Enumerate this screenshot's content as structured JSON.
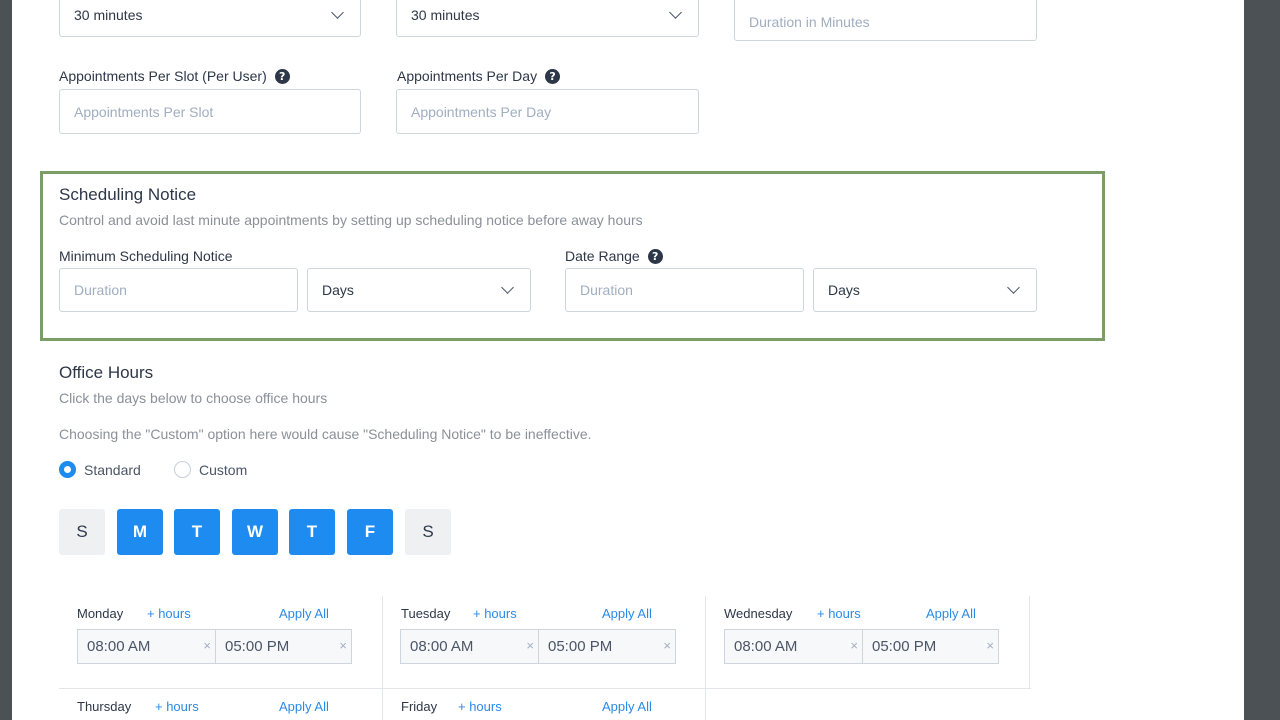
{
  "top_fields": {
    "select_1_value": "30 minutes",
    "select_2_value": "30 minutes",
    "duration_placeholder": "Duration in Minutes",
    "per_slot_label": "Appointments Per Slot (Per User)",
    "per_slot_placeholder": "Appointments Per Slot",
    "per_day_label": "Appointments Per Day",
    "per_day_placeholder": "Appointments Per Day",
    "help_glyph": "?"
  },
  "scheduling_notice": {
    "title": "Scheduling Notice",
    "description": "Control and avoid last minute appointments by setting up scheduling notice before away hours",
    "min_label": "Minimum Scheduling Notice",
    "min_placeholder": "Duration",
    "min_unit": "Days",
    "range_label": "Date Range",
    "range_placeholder": "Duration",
    "range_unit": "Days"
  },
  "office_hours": {
    "title": "Office Hours",
    "description": "Click the days below to choose office hours",
    "warning": "Choosing the \"Custom\" option here would cause \"Scheduling Notice\" to be ineffective.",
    "radio_standard": "Standard",
    "radio_custom": "Custom",
    "selected_mode": "Standard",
    "days": [
      {
        "letter": "S",
        "active": false
      },
      {
        "letter": "M",
        "active": true
      },
      {
        "letter": "T",
        "active": true
      },
      {
        "letter": "W",
        "active": true
      },
      {
        "letter": "T",
        "active": true
      },
      {
        "letter": "F",
        "active": true
      },
      {
        "letter": "S",
        "active": false
      }
    ],
    "add_hours": "+ hours",
    "apply_all": "Apply All",
    "clear_glyph": "×",
    "schedule": [
      {
        "day": "Monday",
        "start": "08:00 AM",
        "end": "05:00 PM"
      },
      {
        "day": "Tuesday",
        "start": "08:00 AM",
        "end": "05:00 PM"
      },
      {
        "day": "Wednesday",
        "start": "08:00 AM",
        "end": "05:00 PM"
      },
      {
        "day": "Thursday"
      },
      {
        "day": "Friday"
      }
    ]
  },
  "colors": {
    "accent": "#1d8bf0",
    "highlight_border": "#7a9e66",
    "backdrop": "#4b5155"
  }
}
